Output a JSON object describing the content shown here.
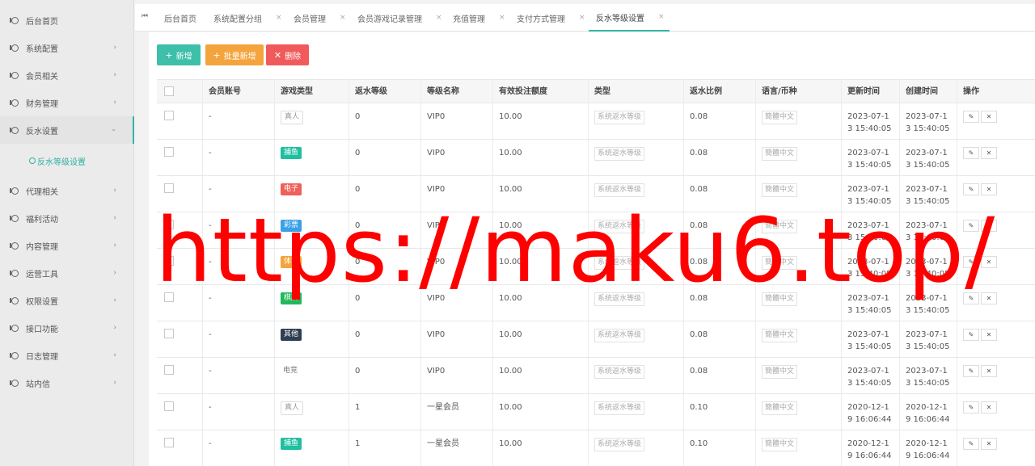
{
  "sidebar": {
    "items": [
      {
        "label": "后台首页",
        "has_arrow": false
      },
      {
        "label": "系统配置",
        "has_arrow": true
      },
      {
        "label": "会员相关",
        "has_arrow": true
      },
      {
        "label": "财务管理",
        "has_arrow": true
      },
      {
        "label": "反水设置",
        "has_arrow": true,
        "expanded": true
      },
      {
        "label": "代理相关",
        "has_arrow": true
      },
      {
        "label": "福利活动",
        "has_arrow": true
      },
      {
        "label": "内容管理",
        "has_arrow": true
      },
      {
        "label": "运营工具",
        "has_arrow": true
      },
      {
        "label": "权限设置",
        "has_arrow": true
      },
      {
        "label": "接口功能",
        "has_arrow": true
      },
      {
        "label": "日志管理",
        "has_arrow": true
      },
      {
        "label": "站内信",
        "has_arrow": true
      }
    ],
    "sub_item": "反水等级设置",
    "arrow_right": "›",
    "arrow_down": "›"
  },
  "tabs": {
    "first_icon": "⏮",
    "items": [
      {
        "label": "后台首页",
        "closable": false
      },
      {
        "label": "系统配置分组",
        "closable": true
      },
      {
        "label": "会员管理",
        "closable": true
      },
      {
        "label": "会员游戏记录管理",
        "closable": true
      },
      {
        "label": "充值管理",
        "closable": true
      },
      {
        "label": "支付方式管理",
        "closable": true
      },
      {
        "label": "反水等级设置",
        "closable": true,
        "active": true
      }
    ],
    "close_glyph": "×"
  },
  "toolbar": {
    "add_label": "新增",
    "add_icon": "+",
    "batch_label": "批量新增",
    "batch_icon": "+",
    "delete_label": "删除",
    "delete_icon": "✕",
    "colors": {
      "add": "#3dbfa9",
      "batch": "#f4a43d",
      "delete": "#f05a5a"
    }
  },
  "table": {
    "headers": [
      "",
      "会员账号",
      "游戏类型",
      "返水等级",
      "等级名称",
      "有效投注额度",
      "类型",
      "返水比例",
      "语言/币种",
      "更新时间",
      "创建时间",
      "操作"
    ],
    "rows": [
      {
        "account": "-",
        "game": "真人",
        "game_style": "plain",
        "level": "0",
        "name": "VIP0",
        "amount": "10.00",
        "type": "系统返水等级",
        "ratio": "0.08",
        "lang": "簡體中文",
        "updated": "2023-07-13 15:40:05",
        "created": "2023-07-13 15:40:05"
      },
      {
        "account": "-",
        "game": "捕鱼",
        "game_style": "filled",
        "game_color": "#1fbfa0",
        "level": "0",
        "name": "VIP0",
        "amount": "10.00",
        "type": "系统返水等级",
        "ratio": "0.08",
        "lang": "簡體中文",
        "updated": "2023-07-13 15:40:05",
        "created": "2023-07-13 15:40:05"
      },
      {
        "account": "-",
        "game": "电子",
        "game_style": "filled",
        "game_color": "#f0605a",
        "level": "0",
        "name": "VIP0",
        "amount": "10.00",
        "type": "系统返水等级",
        "ratio": "0.08",
        "lang": "簡體中文",
        "updated": "2023-07-13 15:40:05",
        "created": "2023-07-13 15:40:05"
      },
      {
        "account": "-",
        "game": "彩票",
        "game_style": "filled",
        "game_color": "#3aa0e8",
        "level": "0",
        "name": "VIP0",
        "amount": "10.00",
        "type": "系统返水等级",
        "ratio": "0.08",
        "lang": "簡體中文",
        "updated": "2023-07-13 15:40:05",
        "created": "2023-07-13 15:40:05"
      },
      {
        "account": "-",
        "game": "体育",
        "game_style": "filled",
        "game_color": "#f4a43d",
        "level": "0",
        "name": "VIP0",
        "amount": "10.00",
        "type": "系统返水等级",
        "ratio": "0.08",
        "lang": "簡體中文",
        "updated": "2023-07-13 15:40:05",
        "created": "2023-07-13 15:40:05"
      },
      {
        "account": "-",
        "game": "棋牌",
        "game_style": "filled",
        "game_color": "#22b85a",
        "level": "0",
        "name": "VIP0",
        "amount": "10.00",
        "type": "系统返水等级",
        "ratio": "0.08",
        "lang": "簡體中文",
        "updated": "2023-07-13 15:40:05",
        "created": "2023-07-13 15:40:05"
      },
      {
        "account": "-",
        "game": "其他",
        "game_style": "filled",
        "game_color": "#2f3e52",
        "level": "0",
        "name": "VIP0",
        "amount": "10.00",
        "type": "系统返水等级",
        "ratio": "0.08",
        "lang": "簡體中文",
        "updated": "2023-07-13 15:40:05",
        "created": "2023-07-13 15:40:05"
      },
      {
        "account": "-",
        "game": "电竞",
        "game_style": "none",
        "level": "0",
        "name": "VIP0",
        "amount": "10.00",
        "type": "系统返水等级",
        "ratio": "0.08",
        "lang": "簡體中文",
        "updated": "2023-07-13 15:40:05",
        "created": "2023-07-13 15:40:05"
      },
      {
        "account": "-",
        "game": "真人",
        "game_style": "plain",
        "level": "1",
        "name": "一星会员",
        "amount": "10.00",
        "type": "系统返水等级",
        "ratio": "0.10",
        "lang": "簡體中文",
        "updated": "2020-12-19 16:06:44",
        "created": "2020-12-19 16:06:44"
      },
      {
        "account": "-",
        "game": "捕鱼",
        "game_style": "filled",
        "game_color": "#1fbfa0",
        "level": "1",
        "name": "一星会员",
        "amount": "10.00",
        "type": "系统返水等级",
        "ratio": "0.10",
        "lang": "簡體中文",
        "updated": "2020-12-19 16:06:44",
        "created": "2020-12-19 16:06:44"
      }
    ],
    "edit_icon": "✎",
    "delete_icon": "✕"
  },
  "watermark": "https://maku6.top/",
  "accent": "#30b8a8"
}
